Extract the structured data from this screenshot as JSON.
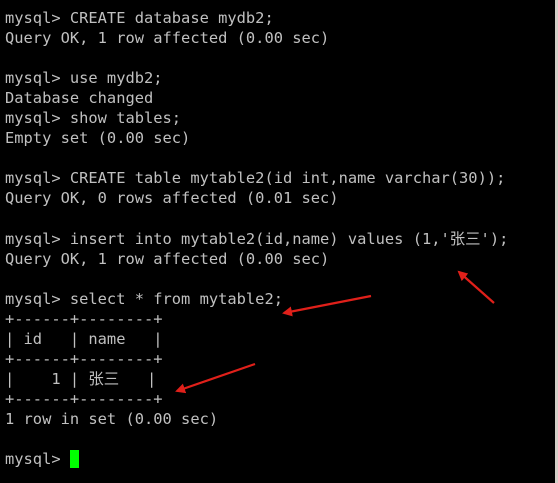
{
  "terminal": {
    "lines": [
      "mysql> CREATE database mydb2;",
      "Query OK, 1 row affected (0.00 sec)",
      "",
      "mysql> use mydb2;",
      "Database changed",
      "mysql> show tables;",
      "Empty set (0.00 sec)",
      "",
      "mysql> CREATE table mytable2(id int,name varchar(30));",
      "Query OK, 0 rows affected (0.01 sec)",
      "",
      "mysql> insert into mytable2(id,name) values (1,'张三');",
      "Query OK, 1 row affected (0.00 sec)",
      "",
      "mysql> select * from mytable2;",
      "+------+--------+",
      "| id   | name   |",
      "+------+--------+",
      "|    1 | 张三   |",
      "+------+--------+",
      "1 row in set (0.00 sec)",
      "",
      "mysql> "
    ],
    "colors": {
      "background": "#000000",
      "text": "#c0c0c0",
      "cursor": "#00ff00",
      "annotation_arrow": "#e0201a"
    }
  },
  "annotations": {
    "arrow_count": 3,
    "icon": "red-arrow-icon"
  }
}
